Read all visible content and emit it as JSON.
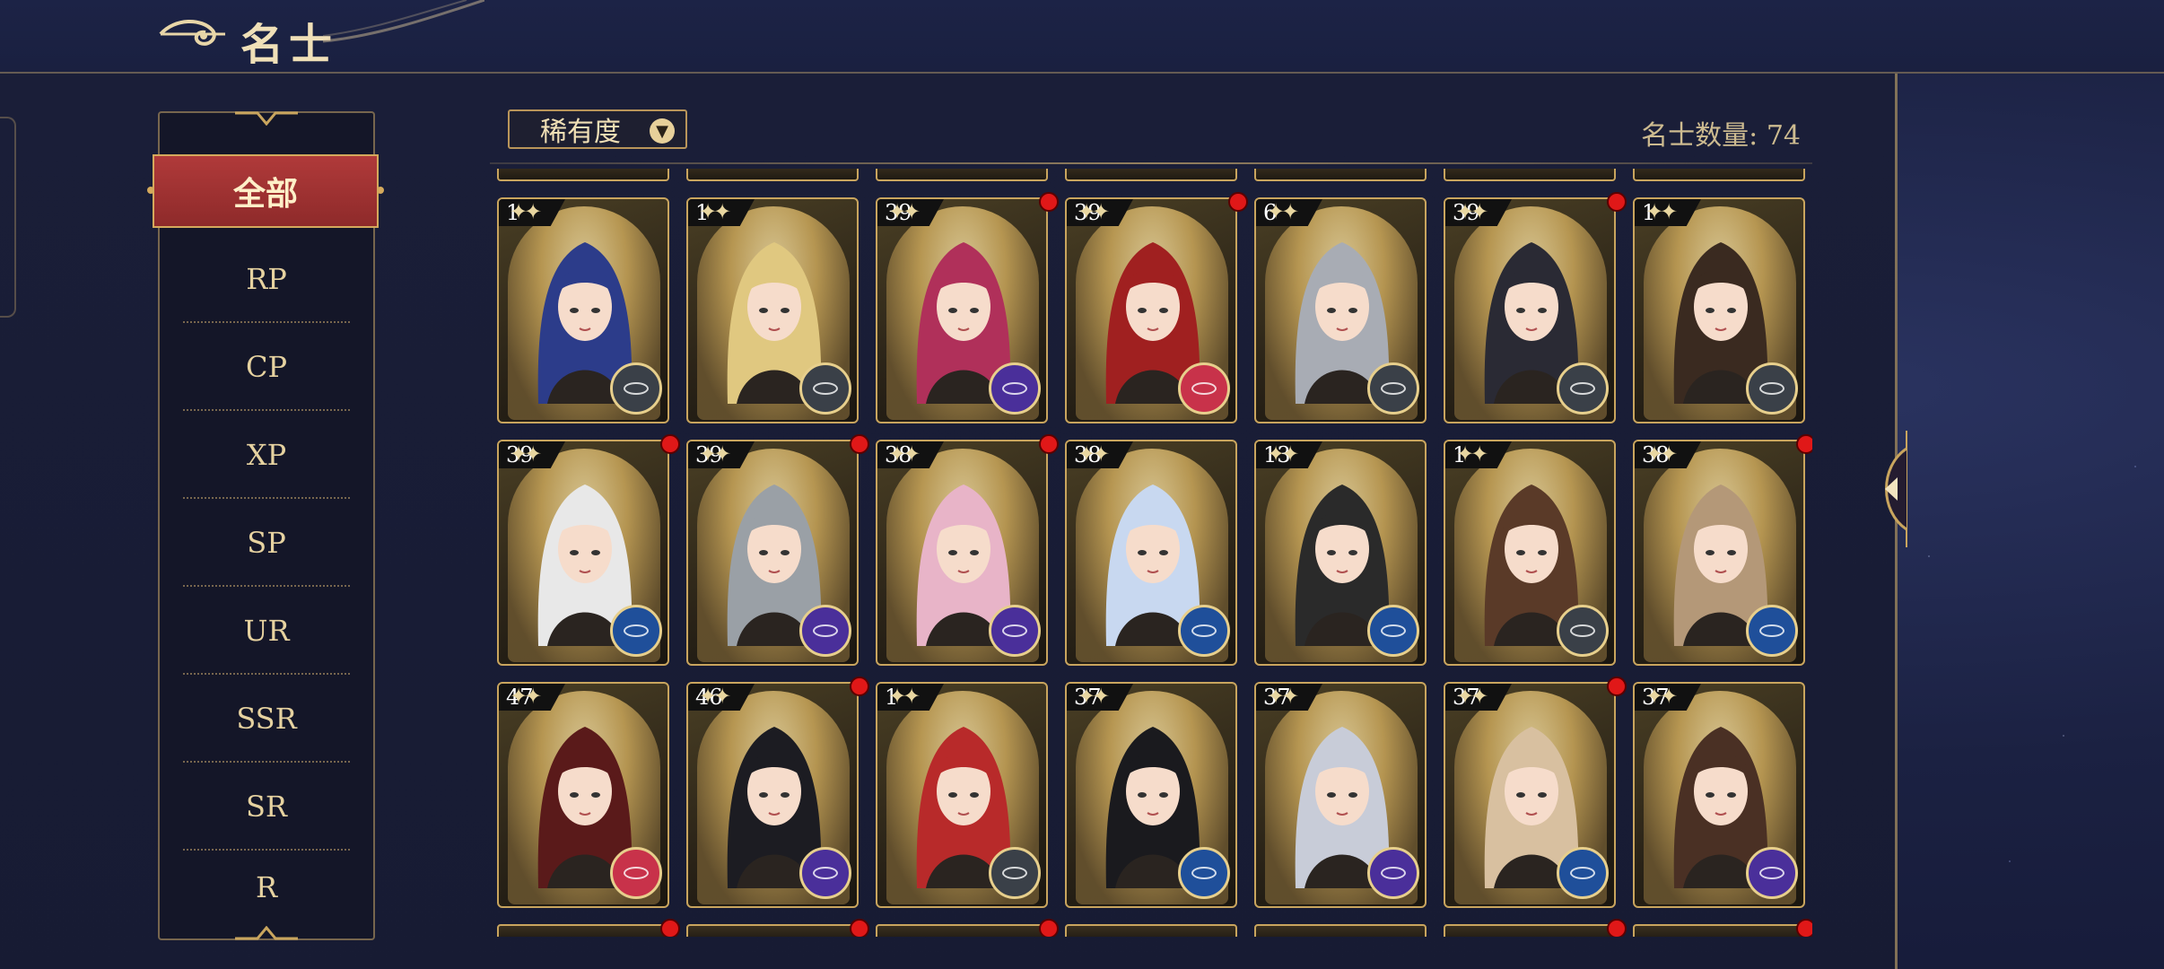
{
  "header": {
    "title": "名士",
    "icon": "cloud-ornament-icon"
  },
  "filters": {
    "active": "全部",
    "items": [
      "RP",
      "CP",
      "XP",
      "SP",
      "UR",
      "SSR",
      "SR",
      "R"
    ]
  },
  "toolbar": {
    "sort_label": "稀有度",
    "sort_icon": "chevron-down-icon",
    "count_text": "名士数量: 74"
  },
  "colors": {
    "accent_gold": "#c9a55e",
    "active_red": "#a23333",
    "panel_dark": "#171b33",
    "element_purple": "#4a2f9a",
    "element_blue": "#1f4f9a",
    "element_gray": "#3a4048",
    "element_red": "#c8324a"
  },
  "cards": [
    {
      "level": "1",
      "hair": "#2c3c8a",
      "element": "gray",
      "dot": false
    },
    {
      "level": "1",
      "hair": "#e0c880",
      "element": "gray",
      "dot": false
    },
    {
      "level": "39",
      "hair": "#b0305a",
      "element": "purple",
      "dot": true
    },
    {
      "level": "39",
      "hair": "#a02020",
      "element": "red",
      "dot": true
    },
    {
      "level": "6",
      "hair": "#a8acb4",
      "element": "gray",
      "dot": false
    },
    {
      "level": "39",
      "hair": "#2a2a34",
      "element": "gray",
      "dot": true
    },
    {
      "level": "1",
      "hair": "#3a2a20",
      "element": "gray",
      "dot": false
    },
    {
      "level": "39",
      "hair": "#e8e8e8",
      "element": "blue",
      "dot": true
    },
    {
      "level": "39",
      "hair": "#9aa0a6",
      "element": "purple",
      "dot": true
    },
    {
      "level": "38",
      "hair": "#e8b4c8",
      "element": "purple",
      "dot": true
    },
    {
      "level": "38",
      "hair": "#c8d8f0",
      "element": "blue",
      "dot": false
    },
    {
      "level": "13",
      "hair": "#2a2a2a",
      "element": "blue",
      "dot": false
    },
    {
      "level": "1",
      "hair": "#5a3a28",
      "element": "gray",
      "dot": false
    },
    {
      "level": "38",
      "hair": "#b49878",
      "element": "blue",
      "dot": true
    },
    {
      "level": "47",
      "hair": "#5a1a1a",
      "element": "red",
      "dot": false
    },
    {
      "level": "46",
      "hair": "#1c1c22",
      "element": "purple",
      "dot": true
    },
    {
      "level": "1",
      "hair": "#b82a2a",
      "element": "gray",
      "dot": false
    },
    {
      "level": "37",
      "hair": "#1a1a1e",
      "element": "blue",
      "dot": false
    },
    {
      "level": "37",
      "hair": "#c8ccd8",
      "element": "purple",
      "dot": false
    },
    {
      "level": "37",
      "hair": "#d8c0a0",
      "element": "blue",
      "dot": true
    },
    {
      "level": "37",
      "hair": "#4a3024",
      "element": "purple",
      "dot": false
    }
  ],
  "peek_row": {
    "dots": [
      true,
      true,
      true,
      false,
      false,
      true,
      true
    ]
  }
}
